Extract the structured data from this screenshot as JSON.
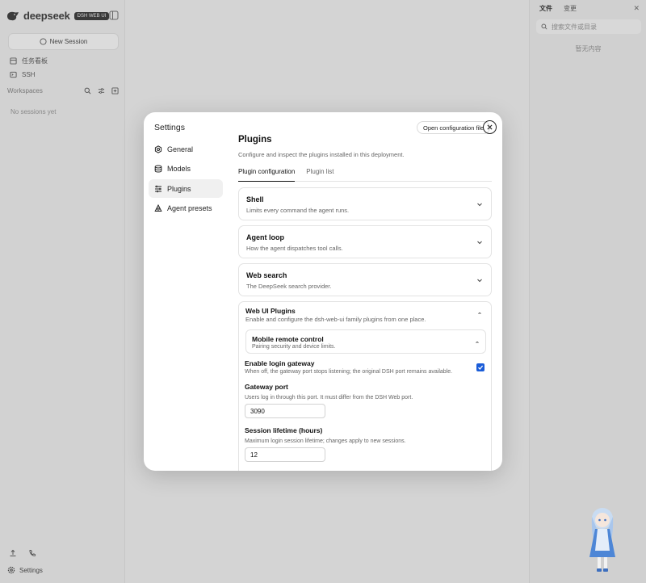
{
  "app": {
    "brand": "deepseek",
    "badge": "DSH WEB UI",
    "new_session": "New Session",
    "links": [
      {
        "label": "任务看板"
      },
      {
        "label": "SSH"
      }
    ],
    "workspaces_title": "Workspaces",
    "no_sessions": "No sessions yet",
    "settings_label": "Settings"
  },
  "right_panel": {
    "tabs": [
      "文件",
      "变更"
    ],
    "search_placeholder": "搜索文件或目录",
    "empty_text": "暂无内容"
  },
  "modal": {
    "title": "Settings",
    "open_config": "Open configuration file",
    "nav": [
      {
        "label": "General",
        "icon": "gear-icon"
      },
      {
        "label": "Models",
        "icon": "database-icon"
      },
      {
        "label": "Plugins",
        "icon": "sliders-icon",
        "active": true
      },
      {
        "label": "Agent presets",
        "icon": "agent-icon"
      }
    ],
    "page_title": "Plugins",
    "page_subtitle": "Configure and inspect the plugins installed in this deployment.",
    "tabs": [
      {
        "label": "Plugin configuration",
        "active": true
      },
      {
        "label": "Plugin list",
        "active": false
      }
    ],
    "cards": [
      {
        "title": "Shell",
        "subtitle": "Limits every command the agent runs."
      },
      {
        "title": "Agent loop",
        "subtitle": "How the agent dispatches tool calls."
      },
      {
        "title": "Web search",
        "subtitle": "The DeepSeek search provider."
      }
    ],
    "webui": {
      "title": "Web UI Plugins",
      "subtitle": "Enable and configure the dsh-web-ui family plugins from one place.",
      "mobile": {
        "title": "Mobile remote control",
        "subtitle": "Pairing security and device limits."
      },
      "gateway": {
        "label": "Enable login gateway",
        "help": "When off, the gateway port stops listening; the original DSH port remains available.",
        "checked": true
      },
      "port": {
        "label": "Gateway port",
        "help": "Users log in through this port. It must differ from the DSH Web port.",
        "value": "3090"
      },
      "session": {
        "label": "Session lifetime (hours)",
        "help": "Maximum login session lifetime; changes apply to new sessions.",
        "value": "12"
      }
    }
  },
  "colors": {
    "accent": "#1a5cd8",
    "backdrop": "#d4d4d4",
    "modal_bg": "#ffffff"
  }
}
